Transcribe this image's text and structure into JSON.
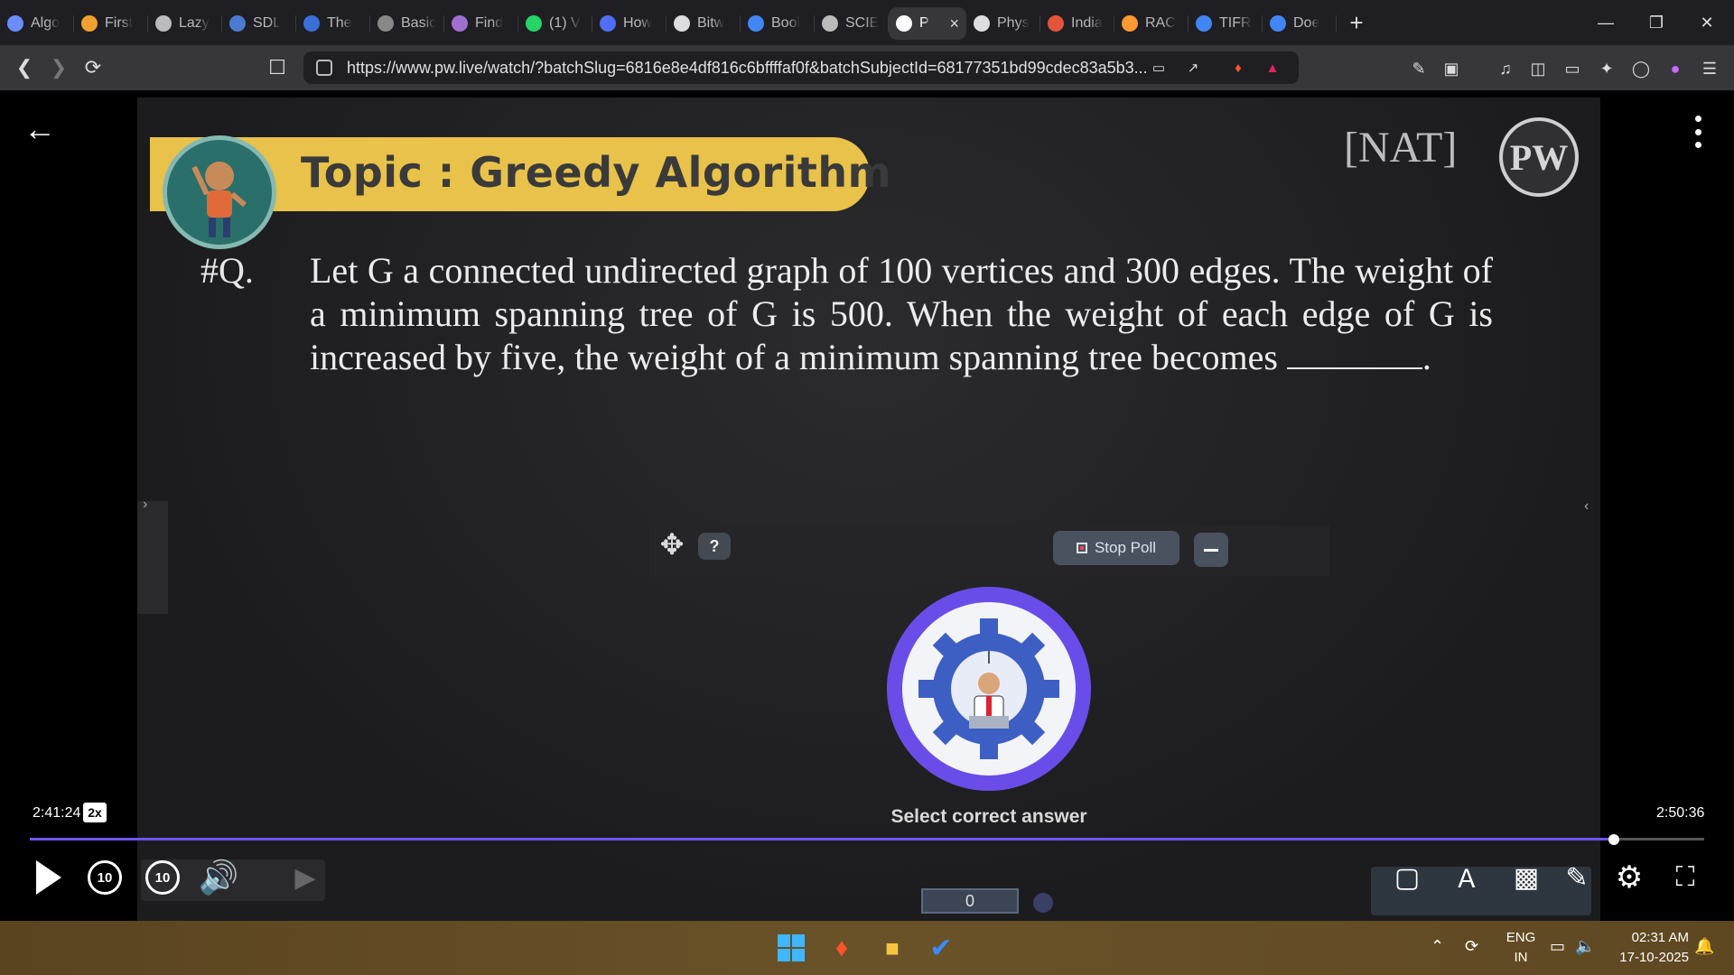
{
  "browser": {
    "tabs": [
      {
        "title": "Algo",
        "icon": "generic-icon",
        "color": "#6a8cff"
      },
      {
        "title": "First",
        "icon": "lightning-icon",
        "color": "#f0a030"
      },
      {
        "title": "Lazy",
        "icon": "globe-icon",
        "color": "#bbbbbb"
      },
      {
        "title": "SDL",
        "icon": "page-icon",
        "color": "#4a7bd0"
      },
      {
        "title": "The",
        "icon": "wave-icon",
        "color": "#3b6fd8"
      },
      {
        "title": "Basic",
        "icon": "page-icon",
        "color": "#888888"
      },
      {
        "title": "Find",
        "icon": "brain-icon",
        "color": "#a070d0"
      },
      {
        "title": "(1) V",
        "icon": "whatsapp-icon",
        "color": "#25d366"
      },
      {
        "title": "How",
        "icon": "bookmark-icon",
        "color": "#4f6df5"
      },
      {
        "title": "Bitw",
        "icon": "text-icon",
        "color": "#dddddd"
      },
      {
        "title": "Bool",
        "icon": "google-icon",
        "color": "#4285f4"
      },
      {
        "title": "SCIE",
        "icon": "globe-icon",
        "color": "#bbbbbb"
      },
      {
        "title": "P",
        "icon": "speaker-icon",
        "color": "#ffffff",
        "active": true
      },
      {
        "title": "Phys",
        "icon": "page-icon",
        "color": "#dddddd"
      },
      {
        "title": "India",
        "icon": "globe-icon",
        "color": "#e2553a"
      },
      {
        "title": "RAC",
        "icon": "flag-icon",
        "color": "#ff9933"
      },
      {
        "title": "TIFR",
        "icon": "google-icon",
        "color": "#4285f4"
      },
      {
        "title": "Doe",
        "icon": "google-icon",
        "color": "#4285f4"
      }
    ],
    "url": "https://www.pw.live/watch/?batchSlug=6816e8e4df816c6bffffaf0f&batchSubjectId=68177351bd99cdec83a5b3..."
  },
  "slide": {
    "topic": "Topic : Greedy Algorithm",
    "tag": "[NAT]",
    "logo_text": "PW",
    "qnum": "#Q.",
    "question": "Let G a connected undirected graph of 100 vertices and 300 edges. The weight of a minimum spanning tree of G is 500. When the weight of each edge of G is increased by five, the weight of a minimum spanning tree becomes",
    "question_end": ".",
    "poll_badge": "?",
    "stop_poll": "Stop Poll",
    "select_prompt": "Select correct answer",
    "answer_count": "0"
  },
  "player": {
    "current_time": "2:41:24",
    "speed": "2x",
    "duration": "2:50:36",
    "progress_fraction": 0.946,
    "skip_back": "10",
    "skip_fwd": "10",
    "accent": "#6d55f0"
  },
  "taskbar": {
    "lang_line1": "ENG",
    "lang_line2": "IN",
    "time": "02:31 AM",
    "date": "17-10-2025"
  }
}
